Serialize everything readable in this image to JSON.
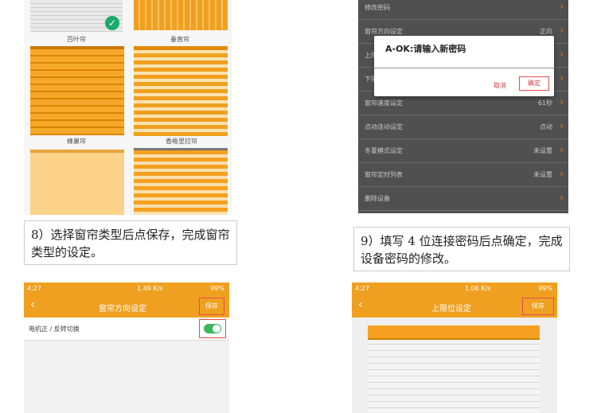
{
  "panel1": {
    "labels": [
      "百叶帘",
      "垂直帘",
      "蜂巢帘",
      "香格里拉帘"
    ]
  },
  "caption1": "8）选择窗帘类型后点保存，完成窗帘类型的设定。",
  "panel2": {
    "rows": [
      {
        "label": "修改密码",
        "value": ""
      },
      {
        "label": "窗帘方向设定",
        "value": "正向"
      },
      {
        "label": "上限位设定",
        "value": ""
      },
      {
        "label": "下限位设定",
        "value": ""
      },
      {
        "label": "窗帘速度设定",
        "value": "61秒"
      },
      {
        "label": "点动连动设定",
        "value": "点动"
      },
      {
        "label": "冬夏模式设定",
        "value": "未设置"
      },
      {
        "label": "窗帘定时列表",
        "value": "未设置"
      },
      {
        "label": "删除设备",
        "value": ""
      }
    ],
    "dialog": {
      "title": "A-OK:请输入新密码",
      "cancel": "取消",
      "confirm": "确定"
    }
  },
  "caption2": "9）填写 4 位连接密码后点确定，完成设备密码的修改。",
  "panel3": {
    "time": "4:27",
    "speed": "1.49 K/s",
    "battery": "99%",
    "title": "窗帘方向设定",
    "save": "保存",
    "row_label": "电机正 / 反转切换",
    "toggle_on": true
  },
  "panel4": {
    "time": "4:27",
    "speed": "1.06 K/s",
    "battery": "99%",
    "title": "上限位设定",
    "save": "保存"
  },
  "colors": {
    "accent": "#f0a020",
    "toggle": "#3cb85c",
    "highlight": "#e05050"
  }
}
